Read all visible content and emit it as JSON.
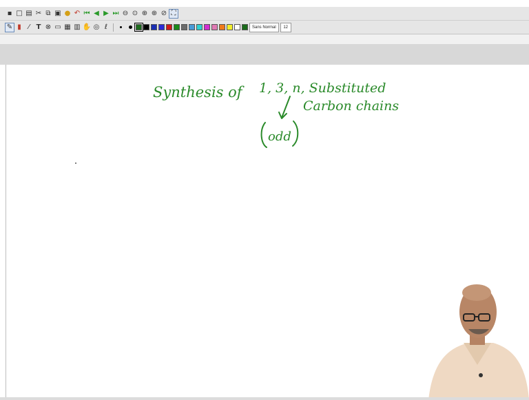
{
  "toolbar_top": {
    "icons": [
      "save-icon",
      "new-page-icon",
      "open-icon",
      "cut-icon",
      "copy-icon",
      "paste-icon",
      "bulb-icon",
      "undo-icon",
      "first-page-icon",
      "prev-page-icon",
      "next-page-icon",
      "last-page-icon",
      "zoom-out-icon",
      "zoom-icon",
      "zoom-fit-icon",
      "zoom-in-icon",
      "zoom-reset-icon",
      "fullscreen-icon"
    ]
  },
  "toolbar_pen": {
    "font_name": "Sans Normal",
    "font_size": "12",
    "colors": [
      "#1d6b1d",
      "#000000",
      "#1a2fb3",
      "#2b2bd6",
      "#d11a1a",
      "#1a8a1a",
      "#6b6b6b",
      "#4a9ad6",
      "#2fd1d1",
      "#d12fd1",
      "#e07ab3",
      "#f07a1a",
      "#f2ef2a",
      "#ffffff",
      "#1a6b1a"
    ],
    "selected_color": "#1d7a1d"
  },
  "whiteboard": {
    "ink_color": "#2a8a2a",
    "line1": "Synthesis of",
    "line1b": "1, 3, n, Substituted",
    "line2": "Carbon chains",
    "circled": "odd"
  }
}
